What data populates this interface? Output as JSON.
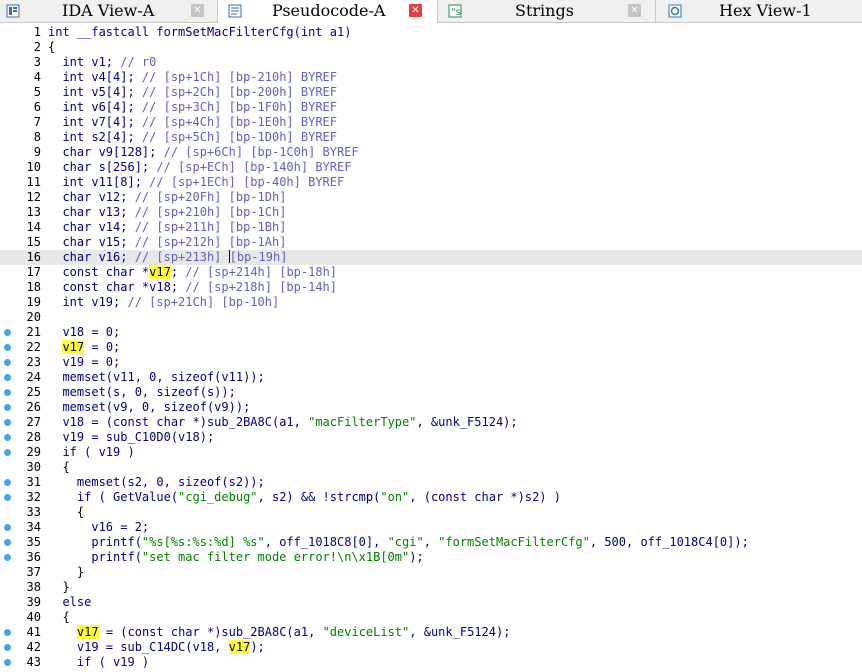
{
  "tabs": [
    {
      "label": "IDA View-A",
      "icon": "ida-view-icon",
      "active": false
    },
    {
      "label": "Pseudocode-A",
      "icon": "pseudocode-icon",
      "active": true
    },
    {
      "label": "Strings",
      "icon": "strings-icon",
      "active": false
    },
    {
      "label": "Hex View-1",
      "icon": "hex-view-icon",
      "active": false
    }
  ],
  "close_glyph": "✕",
  "colors": {
    "breakpoint": "#42a7e8",
    "highlight": "#ffff33",
    "active_close": "#e0413a"
  },
  "lines": [
    {
      "n": "1",
      "bp": false,
      "t": [
        [
          "int __fastcall formSetMacFilterCfg(int a1)",
          "c-type"
        ]
      ]
    },
    {
      "n": "2",
      "bp": false,
      "t": [
        [
          "{",
          ""
        ]
      ]
    },
    {
      "n": "3",
      "bp": false,
      "t": [
        [
          "  int v1; ",
          "c-kw"
        ],
        [
          "// r0",
          "c-cmt"
        ]
      ]
    },
    {
      "n": "4",
      "bp": false,
      "t": [
        [
          "  int v4[4]; ",
          "c-kw"
        ],
        [
          "// [sp+1Ch] [bp-210h] BYREF",
          "c-cmt"
        ]
      ]
    },
    {
      "n": "5",
      "bp": false,
      "t": [
        [
          "  int v5[4]; ",
          "c-kw"
        ],
        [
          "// [sp+2Ch] [bp-200h] BYREF",
          "c-cmt"
        ]
      ]
    },
    {
      "n": "6",
      "bp": false,
      "t": [
        [
          "  int v6[4]; ",
          "c-kw"
        ],
        [
          "// [sp+3Ch] [bp-1F0h] BYREF",
          "c-cmt"
        ]
      ]
    },
    {
      "n": "7",
      "bp": false,
      "t": [
        [
          "  int v7[4]; ",
          "c-kw"
        ],
        [
          "// [sp+4Ch] [bp-1E0h] BYREF",
          "c-cmt"
        ]
      ]
    },
    {
      "n": "8",
      "bp": false,
      "t": [
        [
          "  int s2[4]; ",
          "c-kw"
        ],
        [
          "// [sp+5Ch] [bp-1D0h] BYREF",
          "c-cmt"
        ]
      ]
    },
    {
      "n": "9",
      "bp": false,
      "t": [
        [
          "  char v9[128]; ",
          "c-kw"
        ],
        [
          "// [sp+6Ch] [bp-1C0h] BYREF",
          "c-cmt"
        ]
      ]
    },
    {
      "n": "10",
      "bp": false,
      "t": [
        [
          "  char s[256]; ",
          "c-kw"
        ],
        [
          "// [sp+ECh] [bp-140h] BYREF",
          "c-cmt"
        ]
      ]
    },
    {
      "n": "11",
      "bp": false,
      "t": [
        [
          "  int v11[8]; ",
          "c-kw"
        ],
        [
          "// [sp+1ECh] [bp-40h] BYREF",
          "c-cmt"
        ]
      ]
    },
    {
      "n": "12",
      "bp": false,
      "t": [
        [
          "  char v12; ",
          "c-kw"
        ],
        [
          "// [sp+20Fh] [bp-1Dh]",
          "c-cmt"
        ]
      ]
    },
    {
      "n": "13",
      "bp": false,
      "t": [
        [
          "  char v13; ",
          "c-kw"
        ],
        [
          "// [sp+210h] [bp-1Ch]",
          "c-cmt"
        ]
      ]
    },
    {
      "n": "14",
      "bp": false,
      "t": [
        [
          "  char v14; ",
          "c-kw"
        ],
        [
          "// [sp+211h] [bp-1Bh]",
          "c-cmt"
        ]
      ]
    },
    {
      "n": "15",
      "bp": false,
      "t": [
        [
          "  char v15; ",
          "c-kw"
        ],
        [
          "// [sp+212h] [bp-1Ah]",
          "c-cmt"
        ]
      ]
    },
    {
      "n": "16",
      "bp": false,
      "hl": true,
      "t": [
        [
          "  char v16; ",
          "c-kw"
        ],
        [
          "// [sp+213h] ",
          "c-cmt"
        ],
        [
          "|",
          "caret"
        ],
        [
          "[bp-19h]",
          "c-cmt"
        ]
      ]
    },
    {
      "n": "17",
      "bp": false,
      "t": [
        [
          "  const char *",
          "c-kw"
        ],
        [
          "v17",
          "c-hl"
        ],
        [
          "; ",
          "c-kw"
        ],
        [
          "// [sp+214h] [bp-18h]",
          "c-cmt"
        ]
      ]
    },
    {
      "n": "18",
      "bp": false,
      "t": [
        [
          "  const char *v18; ",
          "c-kw"
        ],
        [
          "// [sp+218h] [bp-14h]",
          "c-cmt"
        ]
      ]
    },
    {
      "n": "19",
      "bp": false,
      "t": [
        [
          "  int v19; ",
          "c-kw"
        ],
        [
          "// [sp+21Ch] [bp-10h]",
          "c-cmt"
        ]
      ]
    },
    {
      "n": "20",
      "bp": false,
      "t": [
        [
          "",
          ""
        ]
      ]
    },
    {
      "n": "21",
      "bp": true,
      "t": [
        [
          "  v18 = 0;",
          "c-var"
        ]
      ]
    },
    {
      "n": "22",
      "bp": true,
      "t": [
        [
          "  ",
          ""
        ],
        [
          "v17",
          "c-hl"
        ],
        [
          " = 0;",
          "c-var"
        ]
      ]
    },
    {
      "n": "23",
      "bp": true,
      "t": [
        [
          "  v19 = 0;",
          "c-var"
        ]
      ]
    },
    {
      "n": "24",
      "bp": true,
      "t": [
        [
          "  memset(v11, 0, sizeof(v11));",
          "c-fn"
        ]
      ]
    },
    {
      "n": "25",
      "bp": true,
      "t": [
        [
          "  memset(s, 0, sizeof(s));",
          "c-fn"
        ]
      ]
    },
    {
      "n": "26",
      "bp": true,
      "t": [
        [
          "  memset(v9, 0, sizeof(v9));",
          "c-fn"
        ]
      ]
    },
    {
      "n": "27",
      "bp": true,
      "t": [
        [
          "  v18 = (const char *)sub_2BA8C(a1, ",
          "c-var"
        ],
        [
          "\"macFilterType\"",
          "c-str"
        ],
        [
          ", &unk_F5124);",
          "c-var"
        ]
      ]
    },
    {
      "n": "28",
      "bp": true,
      "t": [
        [
          "  v19 = sub_C10D0(v18);",
          "c-var"
        ]
      ]
    },
    {
      "n": "29",
      "bp": true,
      "t": [
        [
          "  if ( v19 )",
          "c-kw"
        ]
      ]
    },
    {
      "n": "30",
      "bp": false,
      "t": [
        [
          "  {",
          ""
        ]
      ]
    },
    {
      "n": "31",
      "bp": true,
      "t": [
        [
          "    memset(s2, 0, sizeof(s2));",
          "c-fn"
        ]
      ]
    },
    {
      "n": "32",
      "bp": true,
      "t": [
        [
          "    if ( GetValue(",
          "c-kw"
        ],
        [
          "\"cgi_debug\"",
          "c-str"
        ],
        [
          ", s2) && !strcmp(",
          "c-kw"
        ],
        [
          "\"on\"",
          "c-str"
        ],
        [
          ", (const char *)s2) )",
          "c-kw"
        ]
      ]
    },
    {
      "n": "33",
      "bp": false,
      "t": [
        [
          "    {",
          ""
        ]
      ]
    },
    {
      "n": "34",
      "bp": true,
      "t": [
        [
          "      v16 = 2;",
          "c-var"
        ]
      ]
    },
    {
      "n": "35",
      "bp": true,
      "t": [
        [
          "      printf(",
          "c-fn"
        ],
        [
          "\"%s[%s:%s:%d] %s\"",
          "c-str"
        ],
        [
          ", off_1018C8[0], ",
          "c-fn"
        ],
        [
          "\"cgi\"",
          "c-str"
        ],
        [
          ", ",
          "c-fn"
        ],
        [
          "\"formSetMacFilterCfg\"",
          "c-str"
        ],
        [
          ", 500, off_1018C4[0]);",
          "c-fn"
        ]
      ]
    },
    {
      "n": "36",
      "bp": true,
      "t": [
        [
          "      printf(",
          "c-fn"
        ],
        [
          "\"set mac filter mode error!\\n\\x1B[0m\"",
          "c-str"
        ],
        [
          ");",
          "c-fn"
        ]
      ]
    },
    {
      "n": "37",
      "bp": false,
      "t": [
        [
          "    }",
          ""
        ]
      ]
    },
    {
      "n": "38",
      "bp": false,
      "t": [
        [
          "  }",
          ""
        ]
      ]
    },
    {
      "n": "39",
      "bp": false,
      "t": [
        [
          "  else",
          "c-kw"
        ]
      ]
    },
    {
      "n": "40",
      "bp": false,
      "t": [
        [
          "  {",
          ""
        ]
      ]
    },
    {
      "n": "41",
      "bp": true,
      "t": [
        [
          "    ",
          ""
        ],
        [
          "v17",
          "c-hl"
        ],
        [
          " = (const char *)sub_2BA8C(a1, ",
          "c-var"
        ],
        [
          "\"deviceList\"",
          "c-str"
        ],
        [
          ", &unk_F5124);",
          "c-var"
        ]
      ]
    },
    {
      "n": "42",
      "bp": true,
      "t": [
        [
          "    v19 = sub_C14DC(v18, ",
          "c-var"
        ],
        [
          "v17",
          "c-hl"
        ],
        [
          ");",
          "c-var"
        ]
      ]
    },
    {
      "n": "43",
      "bp": true,
      "t": [
        [
          "    if ( v19 )",
          "c-kw"
        ]
      ]
    }
  ]
}
